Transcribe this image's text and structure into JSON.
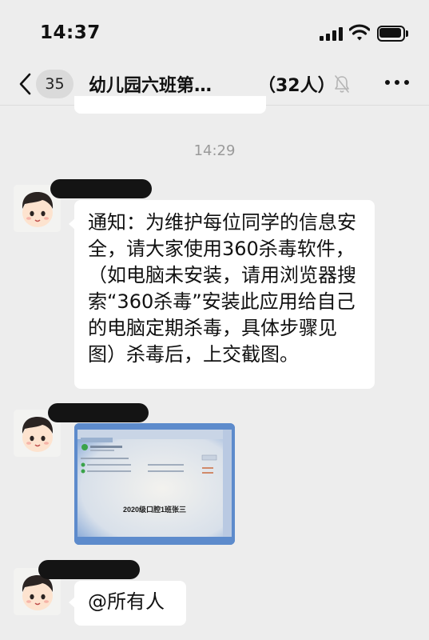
{
  "status_bar": {
    "time": "14:37"
  },
  "nav": {
    "unread_count": "35",
    "title": "幼儿园六班第…",
    "member_count": "（32人）"
  },
  "timestamp": "14:29",
  "messages": [
    {
      "type": "text",
      "text": "通知：为维护每位同学的信息安全，请大家使用360杀毒软件，（如电脑未安装，请用浏览器搜索“360杀毒”安装此应用给自己的电脑定期杀毒，具体步骤见图）杀毒后，上交截图。"
    },
    {
      "type": "image",
      "caption": "2020级口腔1班张三"
    },
    {
      "type": "text",
      "text": "@所有人"
    }
  ],
  "icons": {
    "back": "chevron-left-icon",
    "mute": "bell-muted-icon",
    "more": "ellipsis-icon"
  },
  "colors": {
    "background": "#ededed",
    "bubble": "#ffffff",
    "timestamp": "#9a9a9a",
    "badge": "#dadada"
  }
}
